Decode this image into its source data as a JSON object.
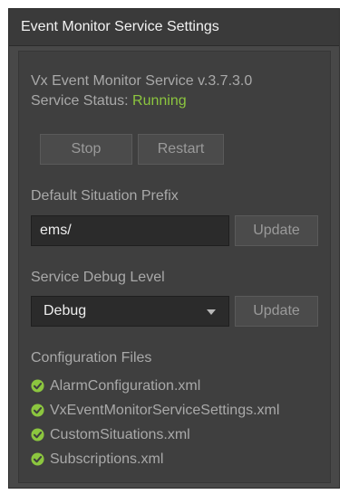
{
  "window": {
    "title": "Event Monitor Service Settings"
  },
  "service": {
    "name_version": "Vx Event Monitor Service v.3.7.3.0",
    "status_label": "Service Status: ",
    "status_value": "Running",
    "status_color": "#8cc63f",
    "stop_label": "Stop",
    "restart_label": "Restart"
  },
  "prefix": {
    "label": "Default Situation Prefix",
    "value": "ems/",
    "update_label": "Update"
  },
  "debug": {
    "label": "Service Debug Level",
    "selected": "Debug",
    "update_label": "Update"
  },
  "config": {
    "label": "Configuration Files",
    "files": [
      {
        "name": "AlarmConfiguration.xml",
        "icon": "check-circle-icon"
      },
      {
        "name": "VxEventMonitorServiceSettings.xml",
        "icon": "check-circle-icon"
      },
      {
        "name": "CustomSituations.xml",
        "icon": "check-circle-icon"
      },
      {
        "name": "Subscriptions.xml",
        "icon": "check-circle-icon"
      }
    ]
  }
}
